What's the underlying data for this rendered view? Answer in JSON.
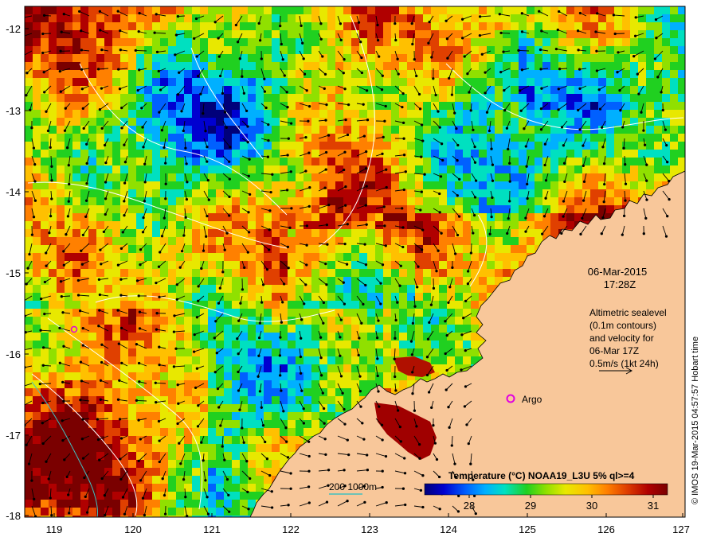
{
  "map": {
    "date": "06-Mar-2015",
    "time": "17:28Z",
    "note_lines": [
      "Altimetric sealevel",
      "(0.1m contours)",
      "and velocity for",
      "06-Mar 17Z",
      "0.5m/s (1kt 24h)"
    ],
    "argo_label": "Argo",
    "bathy_label": "200  1000m",
    "credit": "© IMOS 19-Mar-2015 04:57:57 Hobart time",
    "lat_ticks": [
      "-12",
      "-13",
      "-14",
      "-15",
      "-16",
      "-17",
      "-18"
    ],
    "lon_ticks": [
      "119",
      "120",
      "121",
      "122",
      "123",
      "124",
      "125",
      "126",
      "127"
    ],
    "colors": {
      "land": "#f8c79a",
      "argo": "#e000e0",
      "bathy": "#40c0c0"
    }
  },
  "colorbar": {
    "title": "Temperature (°C) NOAA19_L3U 5% ql>=4",
    "ticks": [
      "28",
      "29",
      "30",
      "31"
    ],
    "colors": [
      "#00007a",
      "#0000d0",
      "#0060ff",
      "#00b0ff",
      "#00e0c0",
      "#20d020",
      "#90e000",
      "#e8e800",
      "#ffc000",
      "#ff8000",
      "#e04000",
      "#b00000",
      "#7a0000"
    ]
  }
}
